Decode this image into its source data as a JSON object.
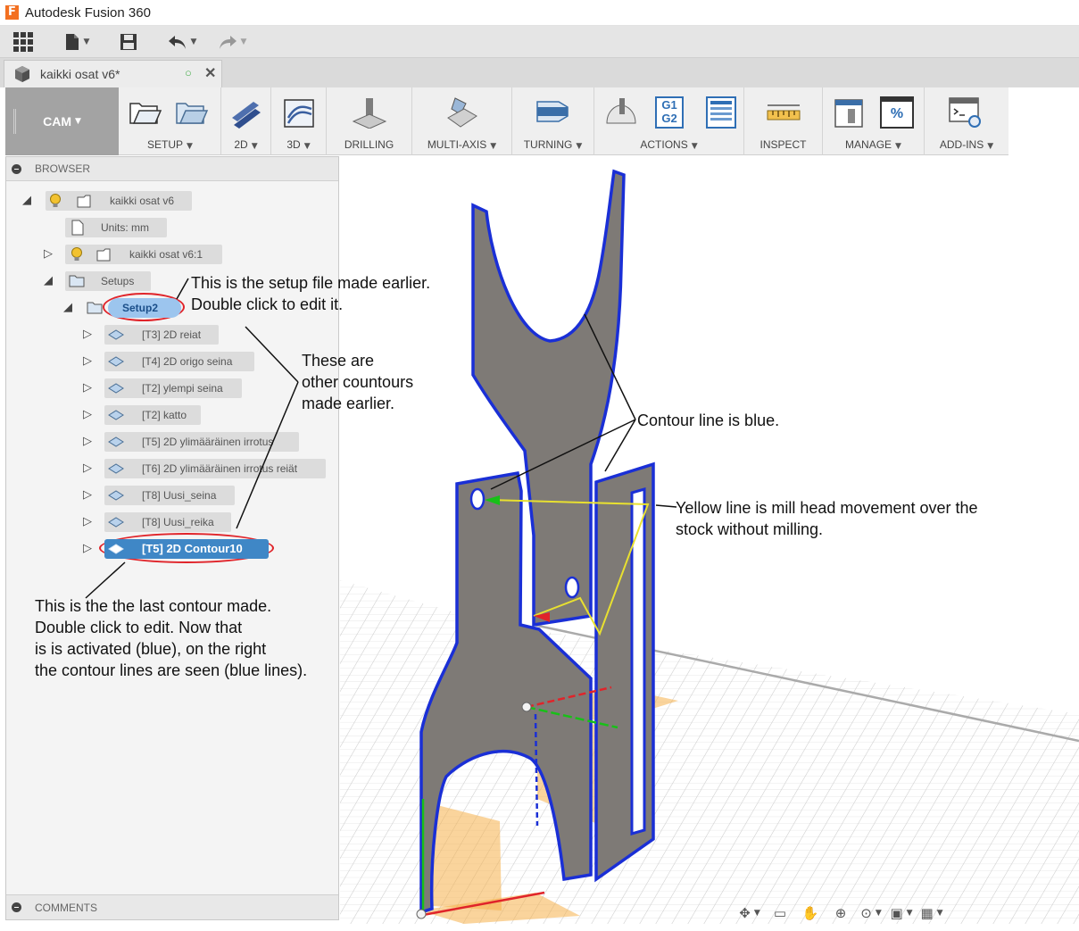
{
  "app": {
    "title": "Autodesk Fusion 360",
    "logo_letter": "F"
  },
  "document_tab": {
    "title": "kaikki osat v6*"
  },
  "ribbon": {
    "workspace": "CAM",
    "groups": [
      "SETUP",
      "2D",
      "3D",
      "DRILLING",
      "MULTI-AXIS",
      "TURNING",
      "ACTIONS",
      "INSPECT",
      "MANAGE",
      "ADD-INS"
    ],
    "actions_icon_text": [
      "G1",
      "G2"
    ],
    "manage_icon_text": "%"
  },
  "browser": {
    "title": "BROWSER",
    "root": "kaikki osat v6",
    "units": "Units: mm",
    "component": "kaikki osat v6:1",
    "setups": "Setups",
    "setup": "Setup2",
    "operations": [
      "[T3] 2D reiat",
      "[T4] 2D origo seina",
      "[T2] ylempi seina",
      "[T2] katto",
      "[T5] 2D ylimääräinen irrotus",
      "[T6] 2D ylimääräinen irrotus reiät",
      "[T8] Uusi_seina",
      "[T8] Uusi_reika",
      "[T5] 2D Contour10"
    ],
    "comments": "COMMENTS"
  },
  "annotations": {
    "setup_note": [
      "This is the setup file made earlier.",
      "Double click to edit it."
    ],
    "others_note": [
      "These are",
      "other countours",
      "made earlier."
    ],
    "contour_note": "Contour line is blue.",
    "yellow_note": [
      "Yellow line is mill head movement over the",
      "stock without milling."
    ],
    "last_note": [
      "This is the the last contour made.",
      "Double click to edit. Now that",
      "is is activated (blue), on the right",
      "the contour lines are seen (blue lines)."
    ]
  },
  "colors": {
    "accent": "#3f87c6",
    "highlight_ring": "#e0242a",
    "contour": "#1a2fd6",
    "toolpath": "#e8e030",
    "part": "#7e7a76",
    "stock": "#f5b04a"
  },
  "navbar": {
    "icons": [
      "orbit-icon",
      "look-at-icon",
      "pan-icon",
      "zoom-icon",
      "fit-icon",
      "display-settings-icon",
      "grid-settings-icon"
    ]
  }
}
